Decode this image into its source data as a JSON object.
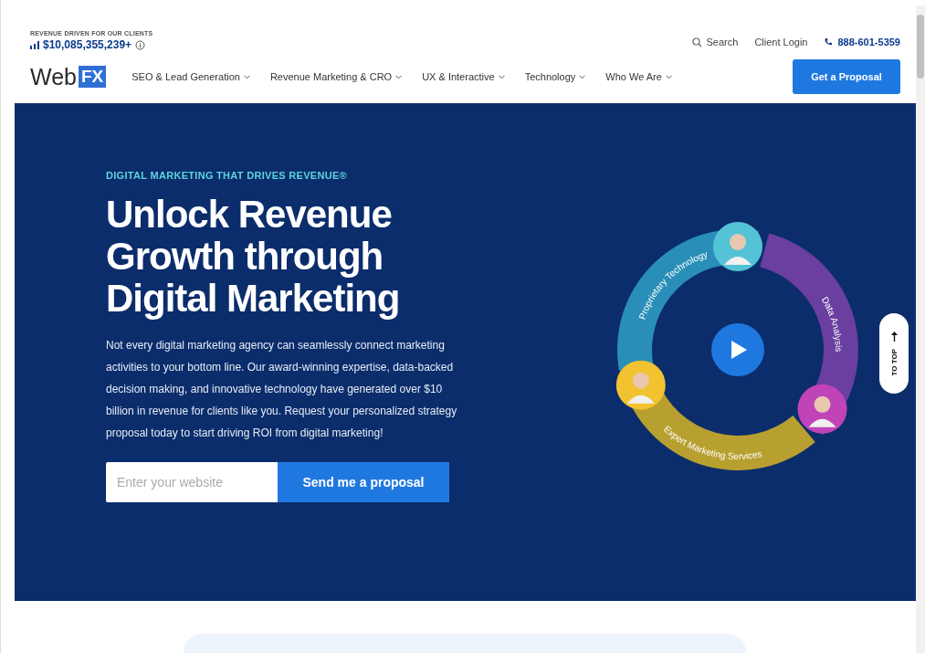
{
  "topbar": {
    "revenue_label": "REVENUE DRIVEN FOR OUR CLIENTS",
    "revenue_value": "$10,085,355,239+",
    "search": "Search",
    "client_login": "Client Login",
    "phone": "888-601-5359"
  },
  "logo": {
    "text": "Web",
    "badge": "FX"
  },
  "nav": [
    {
      "label": "SEO & Lead Generation"
    },
    {
      "label": "Revenue Marketing & CRO"
    },
    {
      "label": "UX & Interactive"
    },
    {
      "label": "Technology"
    },
    {
      "label": "Who We Are"
    }
  ],
  "cta_button": "Get a Proposal",
  "hero": {
    "eyebrow": "DIGITAL MARKETING THAT DRIVES REVENUE®",
    "title": "Unlock Revenue Growth through Digital Marketing",
    "body": "Not every digital marketing agency can seamlessly connect marketing activities to your bottom line. Our award-winning expertise, data-backed decision making, and innovative technology have generated over $10 billion in revenue for clients like you. Request your personalized strategy proposal today to start driving ROI from digital marketing!",
    "placeholder": "Enter your website",
    "submit": "Send me a proposal"
  },
  "ring": {
    "segments": [
      {
        "label": "Proprietary Technology",
        "color": "#2a8fb8"
      },
      {
        "label": "Data Analysis",
        "color": "#6a3fa0"
      },
      {
        "label": "Expert Marketing Services",
        "color": "#b8a030"
      }
    ]
  },
  "to_top": "TO TOP"
}
